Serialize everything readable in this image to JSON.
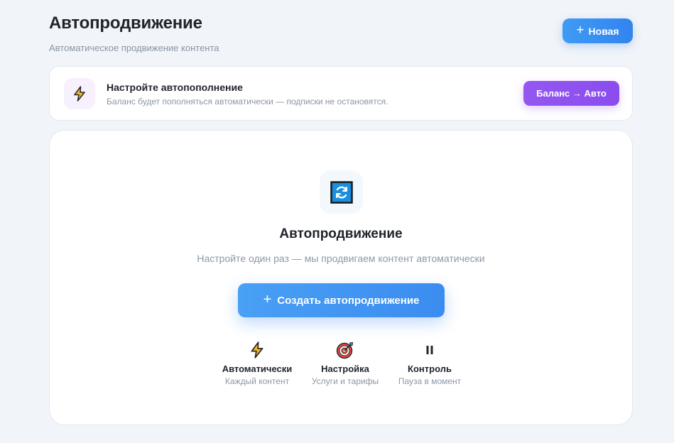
{
  "header": {
    "title": "Автопродвижение",
    "subtitle": "Автоматическое продвижение контента",
    "new_button_icon": "plus-icon",
    "new_button_label": "Новая"
  },
  "autopay_banner": {
    "icon": "lightning-icon",
    "title": "Настройте автопополнение",
    "description": "Баланс будет пополняться автоматически — подписки не остановятся.",
    "button_label": "Баланс → Авто"
  },
  "empty_state": {
    "icon": "refresh-icon",
    "title": "Автопродвижение",
    "subtitle": "Настройте один раз — мы продвигаем контент автоматически",
    "create_button_icon": "plus-icon",
    "create_button_label": "Создать автопродвижение",
    "features": [
      {
        "icon": "lightning-icon",
        "title": "Автоматически",
        "description": "Каждый контент"
      },
      {
        "icon": "target-icon",
        "title": "Настройка",
        "description": "Услуги и тарифы"
      },
      {
        "icon": "pause-icon",
        "title": "Контроль",
        "description": "Пауза в момент"
      }
    ]
  },
  "colors": {
    "background": "#f1f4f8",
    "primary_blue": "#3b8cf0",
    "accent_purple": "#8a4cee",
    "text_dark": "#1f232b",
    "text_muted": "#8d97a6"
  }
}
